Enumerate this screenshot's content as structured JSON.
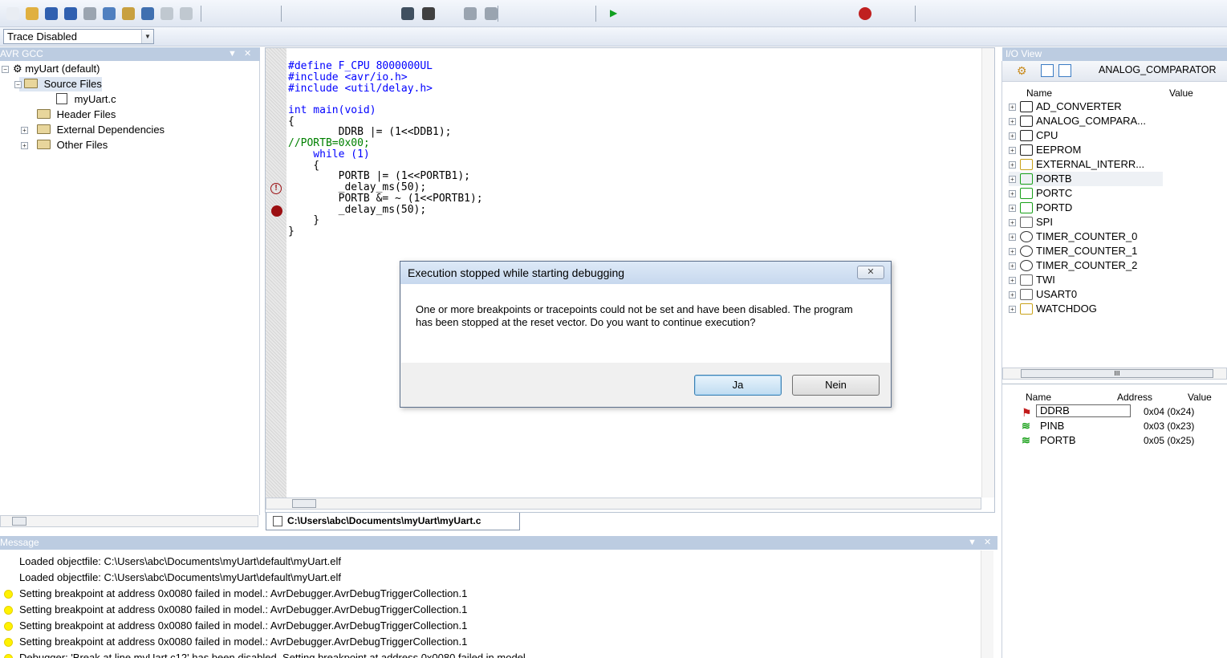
{
  "toolbar": {
    "trace_mode": "Trace Disabled",
    "icons": [
      "new-file-icon",
      "open-icon",
      "save-icon",
      "save-all-icon",
      "cut-icon",
      "copy-icon",
      "paste-icon",
      "print-icon",
      "undo-icon",
      "redo-icon",
      "find-icon",
      "build-icon",
      "run-icon",
      "pause-icon",
      "step-icon",
      "breakpoint-icon"
    ]
  },
  "left_panel": {
    "header": "AVR GCC",
    "tree": [
      {
        "label": "myUart (default)"
      },
      {
        "label": "Source Files"
      },
      {
        "label": "myUart.c"
      },
      {
        "label": "Header Files"
      },
      {
        "label": "External Dependencies"
      },
      {
        "label": "Other Files"
      }
    ]
  },
  "editor": {
    "code_lines": [
      "#define F_CPU 8000000UL",
      "#include <avr/io.h>",
      "#include <util/delay.h>",
      "",
      "int main(void)",
      "{",
      "        DDRB |= (1<<DDB1);",
      "//PORTB=0x00;",
      "    while (1)",
      "    {",
      "        PORTB |= (1<<PORTB1);",
      "        _delay_ms(50);",
      "        PORTB &= ~ (1<<PORTB1);",
      "        _delay_ms(50);",
      "    }",
      "}"
    ],
    "file_tab": "C:\\Users\\abc\\Documents\\myUart\\myUart.c"
  },
  "io_view": {
    "header": "I/O View",
    "selected_module": "ANALOG_COMPARATOR",
    "columns": {
      "name": "Name",
      "value": "Value"
    },
    "modules": [
      "AD_CONVERTER",
      "ANALOG_COMPARA...",
      "CPU",
      "EEPROM",
      "EXTERNAL_INTERR...",
      "PORTB",
      "PORTC",
      "PORTD",
      "SPI",
      "TIMER_COUNTER_0",
      "TIMER_COUNTER_1",
      "TIMER_COUNTER_2",
      "TWI",
      "USART0",
      "WATCHDOG"
    ],
    "scroll_label": "III",
    "reg_columns": {
      "name": "Name",
      "address": "Address",
      "value": "Value"
    },
    "registers": [
      {
        "name": "DDRB",
        "address": "0x04 (0x24)"
      },
      {
        "name": "PINB",
        "address": "0x03 (0x23)"
      },
      {
        "name": "PORTB",
        "address": "0x05 (0x25)"
      }
    ]
  },
  "message_panel": {
    "header": "Message",
    "lines": [
      {
        "text": "Loaded objectfile: C:\\Users\\abc\\Documents\\myUart\\default\\myUart.elf",
        "warn": false
      },
      {
        "text": "Loaded objectfile: C:\\Users\\abc\\Documents\\myUart\\default\\myUart.elf",
        "warn": false
      },
      {
        "text": "Setting breakpoint at address 0x0080 failed in model.: AvrDebugger.AvrDebugTriggerCollection.1",
        "warn": true
      },
      {
        "text": "Setting breakpoint at address 0x0080 failed in model.: AvrDebugger.AvrDebugTriggerCollection.1",
        "warn": true
      },
      {
        "text": "Setting breakpoint at address 0x0080 failed in model.: AvrDebugger.AvrDebugTriggerCollection.1",
        "warn": true
      },
      {
        "text": "Setting breakpoint at address 0x0080 failed in model.: AvrDebugger.AvrDebugTriggerCollection.1",
        "warn": true
      },
      {
        "text": "Debugger: 'Break at line myUart.c12' has been disabled. Setting breakpoint at address 0x0080 failed in model.",
        "warn": true
      }
    ]
  },
  "dialog": {
    "title": "Execution stopped while starting debugging",
    "message": "One or more breakpoints or tracepoints could not be set and have been disabled. The program has been stopped at the reset vector. Do you want to continue execution?",
    "yes_label": "Ja",
    "no_label": "Nein"
  }
}
